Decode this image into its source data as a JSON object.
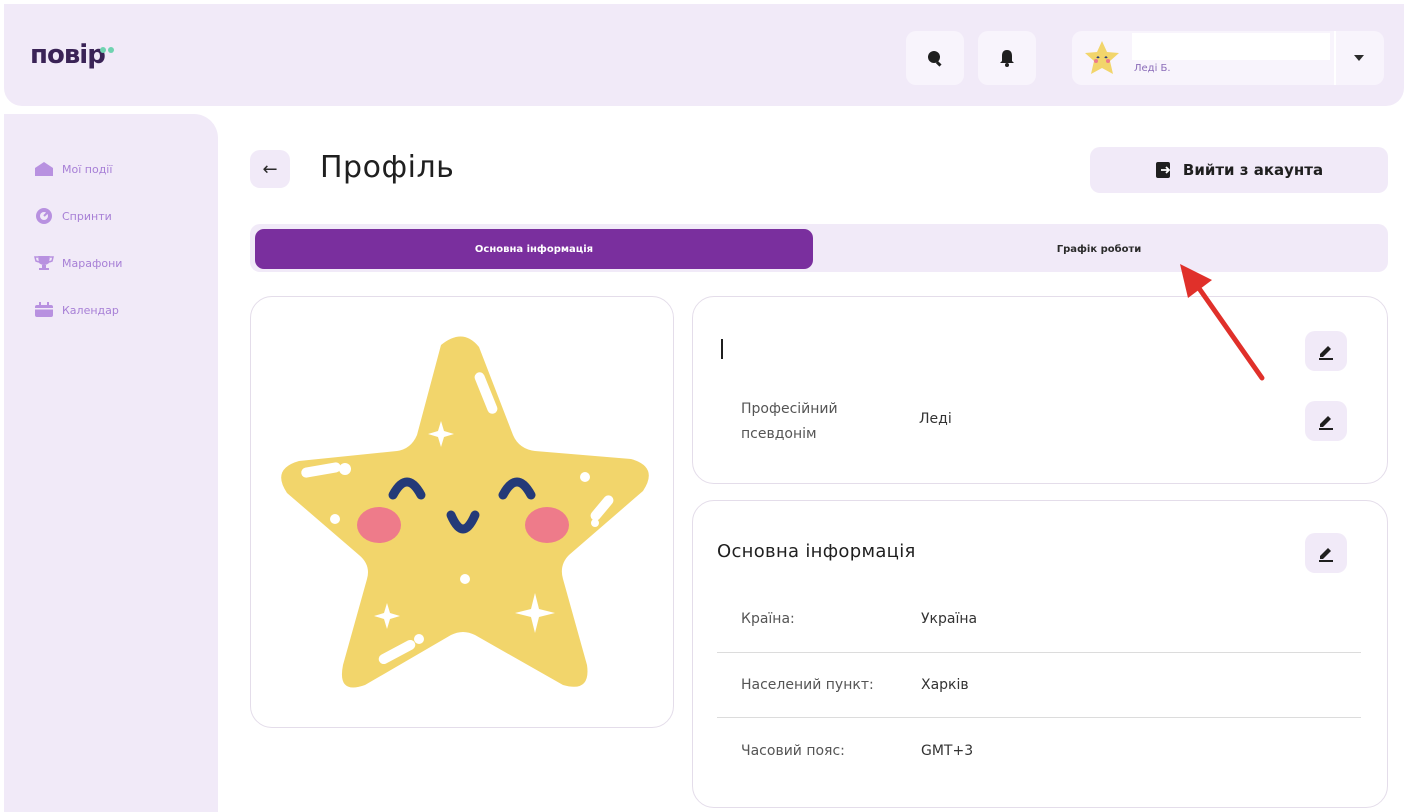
{
  "app": {
    "logo_text": "повір"
  },
  "topbar": {
    "search_icon": "search-icon",
    "bell_icon": "bell-icon",
    "user_nick": "Леді Б."
  },
  "sidebar": {
    "items": [
      {
        "label": "Мої події",
        "icon": "home-icon"
      },
      {
        "label": "Спринти",
        "icon": "target-icon"
      },
      {
        "label": "Марафони",
        "icon": "trophy-icon"
      },
      {
        "label": "Календар",
        "icon": "calendar-icon"
      }
    ]
  },
  "header": {
    "title": "Профіль",
    "logout_label": "Вийти з акаунта"
  },
  "tabs": [
    {
      "label": "Основна інформація",
      "active": true
    },
    {
      "label": "Графік роботи",
      "active": false
    }
  ],
  "nickname_card": {
    "label": "Професійний псевдонім",
    "value": "Леді"
  },
  "info_card": {
    "title": "Основна інформація",
    "rows": [
      {
        "label": "Країна:",
        "value": "Україна"
      },
      {
        "label": "Населений пункт:",
        "value": "Харків"
      },
      {
        "label": "Часовий пояс:",
        "value": "GMT+3"
      }
    ]
  },
  "colors": {
    "accent": "#7a2f9e",
    "panel": "#f1eaf8",
    "star": "#f2d56b",
    "annotation_arrow": "#e0302a"
  }
}
